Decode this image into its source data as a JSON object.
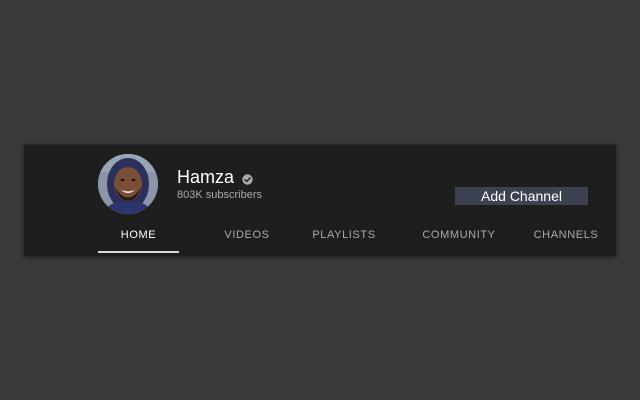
{
  "channel": {
    "name": "Hamza",
    "verified": true,
    "subscribers": "803K subscribers"
  },
  "actions": {
    "add_channel_label": "Add Channel"
  },
  "tabs": [
    {
      "label": "HOME",
      "active": true
    },
    {
      "label": "VIDEOS",
      "active": false
    },
    {
      "label": "PLAYLISTS",
      "active": false
    },
    {
      "label": "COMMUNITY",
      "active": false
    },
    {
      "label": "CHANNELS",
      "active": false
    }
  ],
  "colors": {
    "page_background": "#3a3a3a",
    "header_background": "#1e1e1e",
    "button_background": "#3d4250",
    "active_tab_indicator": "#d9d9d9"
  },
  "icons": {
    "verified": "verified-check-icon"
  }
}
